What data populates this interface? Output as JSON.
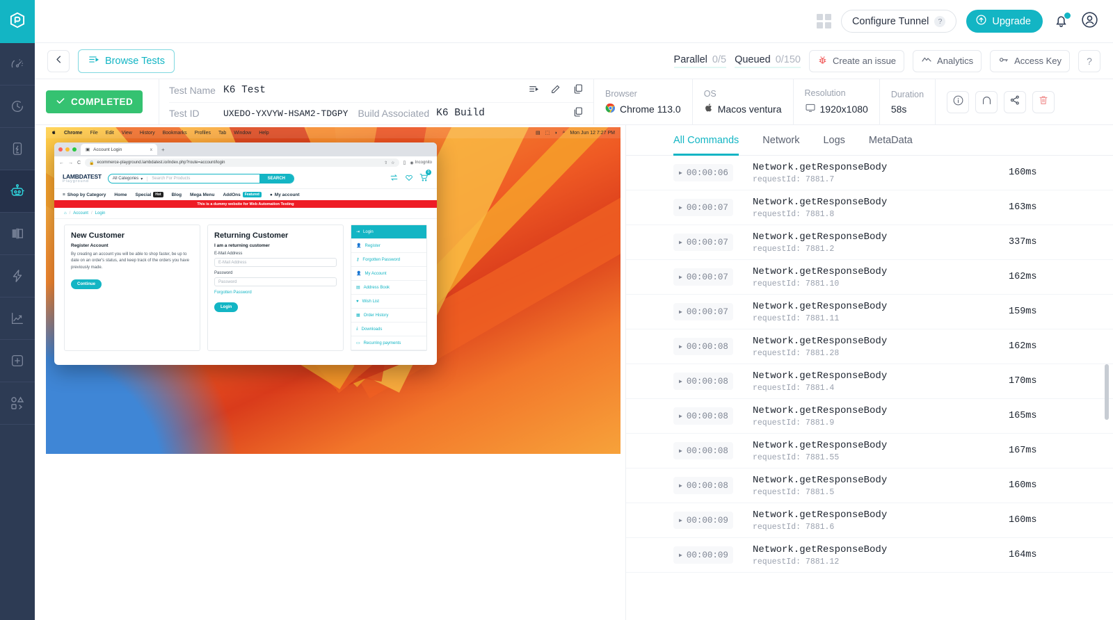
{
  "brand": {
    "accent": "#13b5c4",
    "success": "#35c271",
    "danger": "#ee5c5c",
    "rail_bg": "#2d3b54"
  },
  "topbar": {
    "grid_icon": "grid-icon",
    "configure_tunnel_label": "Configure Tunnel",
    "configure_tunnel_help": "?",
    "upgrade_label": "Upgrade",
    "bell_icon": "bell-icon",
    "avatar_icon": "user-avatar-icon"
  },
  "sidebar": {
    "items": [
      {
        "name": "logo",
        "icon": "lambdatest-logo-icon"
      },
      {
        "name": "realtime",
        "icon": "speedometer-icon"
      },
      {
        "name": "history",
        "icon": "clock-icon"
      },
      {
        "name": "app-testing",
        "icon": "mobile-bolt-icon"
      },
      {
        "name": "automation",
        "icon": "robot-icon",
        "active": true
      },
      {
        "name": "visual-regression",
        "icon": "split-compare-icon"
      },
      {
        "name": "hyperexecute",
        "icon": "lightning-icon"
      },
      {
        "name": "analytics",
        "icon": "trend-chart-icon"
      },
      {
        "name": "integrations",
        "icon": "plus-box-icon"
      },
      {
        "name": "more",
        "icon": "shapes-icon"
      }
    ]
  },
  "subbar": {
    "back_icon": "chevron-left-icon",
    "browse_tests_label": "Browse Tests",
    "browse_tests_icon": "list-play-icon",
    "parallel_label": "Parallel",
    "parallel_value": "0/5",
    "queued_label": "Queued",
    "queued_value": "0/150",
    "create_issue_label": "Create an issue",
    "create_issue_icon": "bug-icon",
    "analytics_label": "Analytics",
    "analytics_icon": "line-chart-icon",
    "access_key_label": "Access Key",
    "access_key_icon": "key-icon",
    "help_label": "?"
  },
  "test": {
    "status": "COMPLETED",
    "status_icon": "check-icon",
    "test_name_label": "Test Name",
    "test_name_value": "K6 Test",
    "test_id_label": "Test ID",
    "test_id_value": "UXEDO-YXVYW-HSAM2-TDGPY",
    "build_label": "Build Associated",
    "build_value": "K6 Build",
    "row_icons": [
      "list-play-icon",
      "edit-pencil-icon",
      "copy-icon"
    ],
    "copy_id_icon": "copy-icon",
    "meta": [
      {
        "key": "Browser",
        "value": "Chrome 113.0",
        "icon": "chrome-icon"
      },
      {
        "key": "OS",
        "value": "Macos ventura",
        "icon": "apple-icon"
      },
      {
        "key": "Resolution",
        "value": "1920x1080",
        "icon": "monitor-icon"
      },
      {
        "key": "Duration",
        "value": "58s",
        "icon": ""
      }
    ],
    "actions": [
      {
        "name": "info-button",
        "icon": "info-circle-icon"
      },
      {
        "name": "tunnel-button",
        "icon": "arch-icon"
      },
      {
        "name": "share-button",
        "icon": "share-icon"
      },
      {
        "name": "delete-button",
        "icon": "trash-icon"
      }
    ]
  },
  "preview": {
    "menubar": {
      "apple": "",
      "app": "Chrome",
      "items": [
        "File",
        "Edit",
        "View",
        "History",
        "Bookmarks",
        "Profiles",
        "Tab",
        "Window",
        "Help"
      ],
      "clock": "Mon Jun 12 7:27 PM"
    },
    "browser": {
      "tab_title": "Account Login",
      "tab_close": "x",
      "new_tab": "+",
      "url": "ecommerce-playground.lambdatest.io/index.php?route=account/login",
      "lock_icon": "lock-icon",
      "incognito_label": "Incognito"
    },
    "site": {
      "logo": "LAMBDATEST",
      "logo_sub": "Playground",
      "category_label": "All Categories",
      "search_placeholder": "Search For Products",
      "search_button": "SEARCH",
      "cart_count": "0",
      "nav": [
        {
          "label": "Shop by Category",
          "tag": ""
        },
        {
          "label": "Home",
          "tag": ""
        },
        {
          "label": "Special",
          "tag": "Hot"
        },
        {
          "label": "Blog",
          "tag": ""
        },
        {
          "label": "Mega Menu",
          "tag": ""
        },
        {
          "label": "AddOns",
          "tag": "Featured"
        },
        {
          "label": "My account",
          "tag": ""
        }
      ],
      "banner": "This is a dummy website for Web Automation Testing",
      "breadcrumb": [
        "Account",
        "Login"
      ],
      "new_customer": {
        "title": "New Customer",
        "subtitle": "Register Account",
        "body": "By creating an account you will be able to shop faster, be up to date on an order's status, and keep track of the orders you have previously made.",
        "button": "Continue"
      },
      "returning_customer": {
        "title": "Returning Customer",
        "subtitle": "I am a returning customer",
        "email_label": "E-Mail Address",
        "email_placeholder": "E-Mail Address",
        "password_label": "Password",
        "password_placeholder": "Password",
        "forgot_link": "Forgotten Password",
        "button": "Login"
      },
      "account_menu": [
        {
          "label": "Login",
          "icon": "login-icon",
          "selected": true
        },
        {
          "label": "Register",
          "icon": "user-plus-icon"
        },
        {
          "label": "Forgotten Password",
          "icon": "key-icon"
        },
        {
          "label": "My Account",
          "icon": "user-icon"
        },
        {
          "label": "Address Book",
          "icon": "book-icon"
        },
        {
          "label": "Wish List",
          "icon": "heart-icon"
        },
        {
          "label": "Order History",
          "icon": "bag-icon"
        },
        {
          "label": "Downloads",
          "icon": "download-icon"
        },
        {
          "label": "Recurring payments",
          "icon": "card-icon"
        }
      ]
    }
  },
  "panel": {
    "tabs": [
      {
        "label": "All Commands",
        "active": true
      },
      {
        "label": "Network",
        "active": false
      },
      {
        "label": "Logs",
        "active": false
      },
      {
        "label": "MetaData",
        "active": false
      }
    ],
    "rows": [
      {
        "time": "00:00:06",
        "command": "Network.getResponseBody",
        "detail": "requestId: 7881.7",
        "duration": "160ms"
      },
      {
        "time": "00:00:07",
        "command": "Network.getResponseBody",
        "detail": "requestId: 7881.8",
        "duration": "163ms"
      },
      {
        "time": "00:00:07",
        "command": "Network.getResponseBody",
        "detail": "requestId: 7881.2",
        "duration": "337ms"
      },
      {
        "time": "00:00:07",
        "command": "Network.getResponseBody",
        "detail": "requestId: 7881.10",
        "duration": "162ms"
      },
      {
        "time": "00:00:07",
        "command": "Network.getResponseBody",
        "detail": "requestId: 7881.11",
        "duration": "159ms"
      },
      {
        "time": "00:00:08",
        "command": "Network.getResponseBody",
        "detail": "requestId: 7881.28",
        "duration": "162ms"
      },
      {
        "time": "00:00:08",
        "command": "Network.getResponseBody",
        "detail": "requestId: 7881.4",
        "duration": "170ms"
      },
      {
        "time": "00:00:08",
        "command": "Network.getResponseBody",
        "detail": "requestId: 7881.9",
        "duration": "165ms"
      },
      {
        "time": "00:00:08",
        "command": "Network.getResponseBody",
        "detail": "requestId: 7881.55",
        "duration": "167ms"
      },
      {
        "time": "00:00:08",
        "command": "Network.getResponseBody",
        "detail": "requestId: 7881.5",
        "duration": "160ms"
      },
      {
        "time": "00:00:09",
        "command": "Network.getResponseBody",
        "detail": "requestId: 7881.6",
        "duration": "160ms"
      },
      {
        "time": "00:00:09",
        "command": "Network.getResponseBody",
        "detail": "requestId: 7881.12",
        "duration": "164ms"
      }
    ]
  }
}
